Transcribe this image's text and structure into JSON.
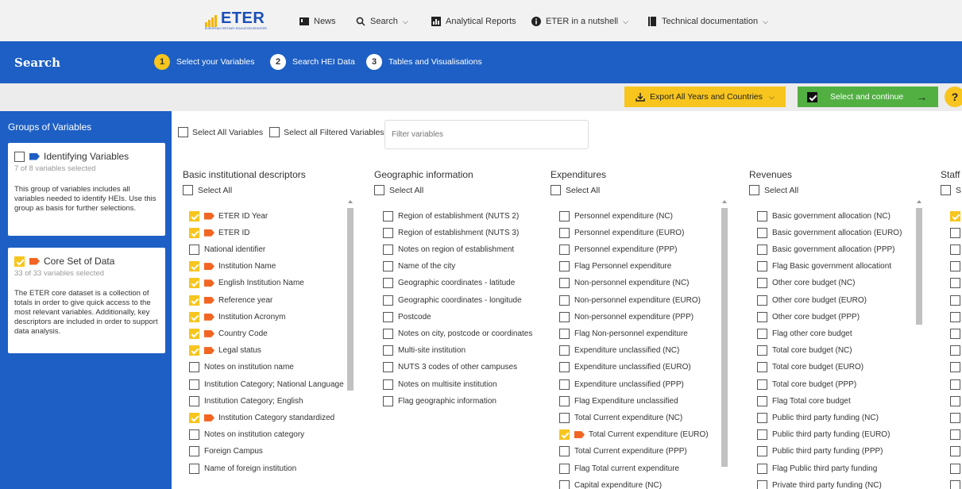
{
  "nav": {
    "logo_text": "ETER",
    "logo_sub": "EUROPEAN TERTIARY EDUCATION REGISTER",
    "items": [
      {
        "label": "News",
        "icon": "news-icon"
      },
      {
        "label": "Search",
        "icon": "search-icon"
      },
      {
        "label": "Analytical Reports",
        "icon": "bar-chart-icon"
      },
      {
        "label": "ETER in a nutshell",
        "icon": "info-icon"
      },
      {
        "label": "Technical documentation",
        "icon": "book-icon"
      }
    ]
  },
  "header": {
    "title": "Search",
    "steps": [
      {
        "num": "1",
        "label": "Select your Variables",
        "active": true
      },
      {
        "num": "2",
        "label": "Search HEI Data",
        "active": false
      },
      {
        "num": "3",
        "label": "Tables and Visualisations",
        "active": false
      }
    ]
  },
  "actions": {
    "export_label": "Export All Years and Countries",
    "continue_label": "Select and continue",
    "help_label": "?"
  },
  "sidebar": {
    "heading": "Groups of Variables",
    "groups": [
      {
        "title": "Identifying Variables",
        "sub": "7 of 8 variables selected",
        "desc": "This group of variables includes all variables needed to identify HEIs. Use this group as basis for further selections.",
        "checked": false
      },
      {
        "title": "Core Set of Data",
        "sub": "33 of 33 variables selected",
        "desc": "The ETER core dataset is a collection of totals in order to give quick access to the most relevant variables. Additionally, key descriptors are included in order to support data analysis.",
        "checked": true
      }
    ]
  },
  "filters": {
    "select_all_variables": "Select All Variables",
    "select_all_filtered": "Select all Filtered Variables",
    "filter_placeholder": "Filter variables"
  },
  "columns": [
    {
      "title": "Basic institutional descriptors",
      "select_all": "Select All",
      "items": [
        {
          "label": "ETER ID Year",
          "checked": true
        },
        {
          "label": "ETER ID",
          "checked": true
        },
        {
          "label": "National identifier",
          "checked": false
        },
        {
          "label": "Institution Name",
          "checked": true
        },
        {
          "label": "English Institution Name",
          "checked": true
        },
        {
          "label": "Reference year",
          "checked": true
        },
        {
          "label": "Institution Acronym",
          "checked": true
        },
        {
          "label": "Country Code",
          "checked": true
        },
        {
          "label": "Legal status",
          "checked": true
        },
        {
          "label": "Notes on institution name",
          "checked": false
        },
        {
          "label": "Institution Category; National Language",
          "checked": false
        },
        {
          "label": "Institution Category; English",
          "checked": false
        },
        {
          "label": "Institution Category standardized",
          "checked": true
        },
        {
          "label": "Notes on institution category",
          "checked": false
        },
        {
          "label": "Foreign Campus",
          "checked": false
        },
        {
          "label": "Name of foreign institution",
          "checked": false
        }
      ]
    },
    {
      "title": "Geographic information",
      "select_all": "Select All",
      "items": [
        {
          "label": "Region of establishment (NUTS 2)",
          "checked": false
        },
        {
          "label": "Region of establishment (NUTS 3)",
          "checked": false
        },
        {
          "label": "Notes on region of establishment",
          "checked": false
        },
        {
          "label": "Name of the city",
          "checked": false
        },
        {
          "label": "Geographic coordinates - latitude",
          "checked": false
        },
        {
          "label": "Geographic coordinates - longitude",
          "checked": false
        },
        {
          "label": "Postcode",
          "checked": false
        },
        {
          "label": "Notes on city, postcode or coordinates",
          "checked": false
        },
        {
          "label": "Multi-site institution",
          "checked": false
        },
        {
          "label": "NUTS 3 codes of other campuses",
          "checked": false
        },
        {
          "label": "Notes on multisite institution",
          "checked": false
        },
        {
          "label": "Flag geographic information",
          "checked": false
        }
      ]
    },
    {
      "title": "Expenditures",
      "select_all": "Select All",
      "items": [
        {
          "label": "Personnel expenditure (NC)",
          "checked": false
        },
        {
          "label": "Personnel expenditure (EURO)",
          "checked": false
        },
        {
          "label": "Personnel expenditure (PPP)",
          "checked": false
        },
        {
          "label": "Flag Personnel expenditure",
          "checked": false
        },
        {
          "label": "Non-personnel expenditure (NC)",
          "checked": false
        },
        {
          "label": "Non-personnel expenditure (EURO)",
          "checked": false
        },
        {
          "label": "Non-personnel expenditure (PPP)",
          "checked": false
        },
        {
          "label": "Flag Non-personnel expenditure",
          "checked": false
        },
        {
          "label": "Expenditure unclassified (NC)",
          "checked": false
        },
        {
          "label": "Expenditure unclassified (EURO)",
          "checked": false
        },
        {
          "label": "Expenditure unclassified (PPP)",
          "checked": false
        },
        {
          "label": "Flag Expenditure unclassified",
          "checked": false
        },
        {
          "label": "Total Current expenditure (NC)",
          "checked": false
        },
        {
          "label": "Total Current expenditure (EURO)",
          "checked": true
        },
        {
          "label": "Total Current expenditure (PPP)",
          "checked": false
        },
        {
          "label": "Flag Total current expenditure",
          "checked": false
        },
        {
          "label": "Capital expenditure (NC)",
          "checked": false
        }
      ]
    },
    {
      "title": "Revenues",
      "select_all": "Select All",
      "items": [
        {
          "label": "Basic government allocation (NC)",
          "checked": false
        },
        {
          "label": "Basic government allocation (EURO)",
          "checked": false
        },
        {
          "label": "Basic government allocation (PPP)",
          "checked": false
        },
        {
          "label": "Flag Basic government allocationt",
          "checked": false
        },
        {
          "label": "Other core budget (NC)",
          "checked": false
        },
        {
          "label": "Other core budget (EURO)",
          "checked": false
        },
        {
          "label": "Other core budget (PPP)",
          "checked": false
        },
        {
          "label": "Flag other core budget",
          "checked": false
        },
        {
          "label": "Total core budget (NC)",
          "checked": false
        },
        {
          "label": "Total core budget (EURO)",
          "checked": false
        },
        {
          "label": "Total core budget (PPP)",
          "checked": false
        },
        {
          "label": "Flag Total core budget",
          "checked": false
        },
        {
          "label": "Public third party funding (NC)",
          "checked": false
        },
        {
          "label": "Public third party funding (EURO)",
          "checked": false
        },
        {
          "label": "Public third party funding (PPP)",
          "checked": false
        },
        {
          "label": "Flag Public third party funding",
          "checked": false
        },
        {
          "label": "Private third party funding (NC)",
          "checked": false
        }
      ]
    },
    {
      "title": "Staff",
      "select_all": "S",
      "items": [
        {
          "label": "",
          "checked": true
        },
        {
          "label": "",
          "checked": false
        },
        {
          "label": "",
          "checked": false
        },
        {
          "label": "",
          "checked": false
        },
        {
          "label": "",
          "checked": false
        },
        {
          "label": "",
          "checked": false
        },
        {
          "label": "",
          "checked": false
        },
        {
          "label": "",
          "checked": false
        },
        {
          "label": "",
          "checked": false
        },
        {
          "label": "",
          "checked": false
        },
        {
          "label": "",
          "checked": false
        },
        {
          "label": "",
          "checked": false
        },
        {
          "label": "",
          "checked": false
        },
        {
          "label": "",
          "checked": false
        },
        {
          "label": "",
          "checked": false
        },
        {
          "label": "",
          "checked": false
        },
        {
          "label": "",
          "checked": false
        }
      ]
    }
  ],
  "colors": {
    "brand_blue": "#1d5fc4",
    "accent_yellow": "#f7c51e",
    "accent_green": "#52b043",
    "tag_orange": "#f26522"
  }
}
